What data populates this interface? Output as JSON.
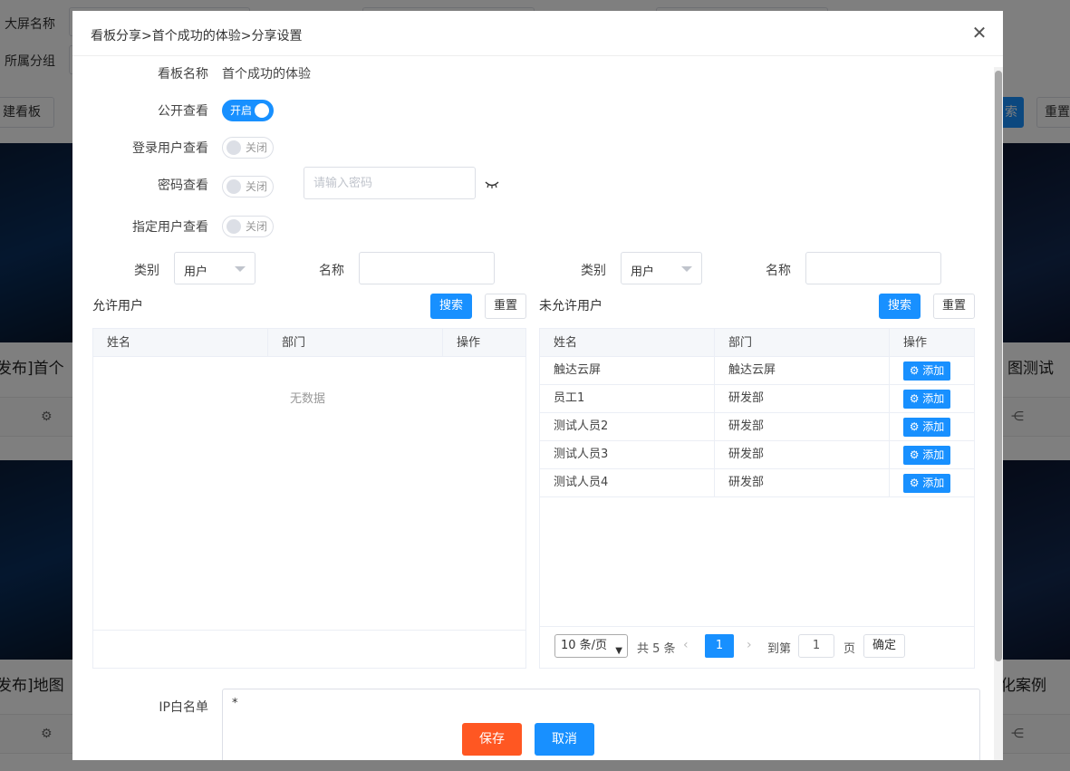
{
  "background": {
    "filter_labels": [
      "大屏名称",
      "所属分组"
    ],
    "create_button": "建看板",
    "right_buttons": [
      "索",
      "重置"
    ],
    "card_titles": [
      "发布]首个",
      "发布]地图",
      "图测试",
      "化案例"
    ]
  },
  "dialog": {
    "title": "看板分享>首个成功的体验>分享设置",
    "close_icon": "close-icon",
    "board_name_label": "看板名称",
    "board_name_value": "首个成功的体验",
    "public_view_label": "公开查看",
    "public_view_state": "开启",
    "login_view_label": "登录用户查看",
    "login_view_state": "关闭",
    "password_view_label": "密码查看",
    "password_view_state": "关闭",
    "password_placeholder": "请输入密码",
    "specific_view_label": "指定用户查看",
    "specific_view_state": "关闭",
    "left_filter": {
      "category_label": "类别",
      "category_value": "用户",
      "name_label": "名称"
    },
    "right_filter": {
      "category_label": "类别",
      "category_value": "用户",
      "name_label": "名称"
    },
    "allowed": {
      "title": "允许用户",
      "search_button": "搜索",
      "reset_button": "重置",
      "columns": [
        "姓名",
        "部门",
        "操作"
      ],
      "empty_text": "无数据"
    },
    "not_allowed": {
      "title": "未允许用户",
      "search_button": "搜索",
      "reset_button": "重置",
      "columns": [
        "姓名",
        "部门",
        "操作"
      ],
      "add_label": "添加",
      "rows": [
        {
          "name": "触达云屏",
          "dept": "触达云屏"
        },
        {
          "name": "员工1",
          "dept": "研发部"
        },
        {
          "name": "测试人员2",
          "dept": "研发部"
        },
        {
          "name": "测试人员3",
          "dept": "研发部"
        },
        {
          "name": "测试人员4",
          "dept": "研发部"
        }
      ]
    },
    "pager": {
      "page_size": "10 条/页",
      "total": "共 5 条",
      "current_page": "1",
      "goto_label": "到第",
      "goto_value": "1",
      "page_unit": "页",
      "confirm": "确定"
    },
    "ip_whitelist_label": "IP白名单",
    "ip_whitelist_value": "*",
    "save_button": "保存",
    "cancel_button": "取消"
  },
  "colors": {
    "primary": "#1890ff",
    "save": "#ff5722"
  }
}
